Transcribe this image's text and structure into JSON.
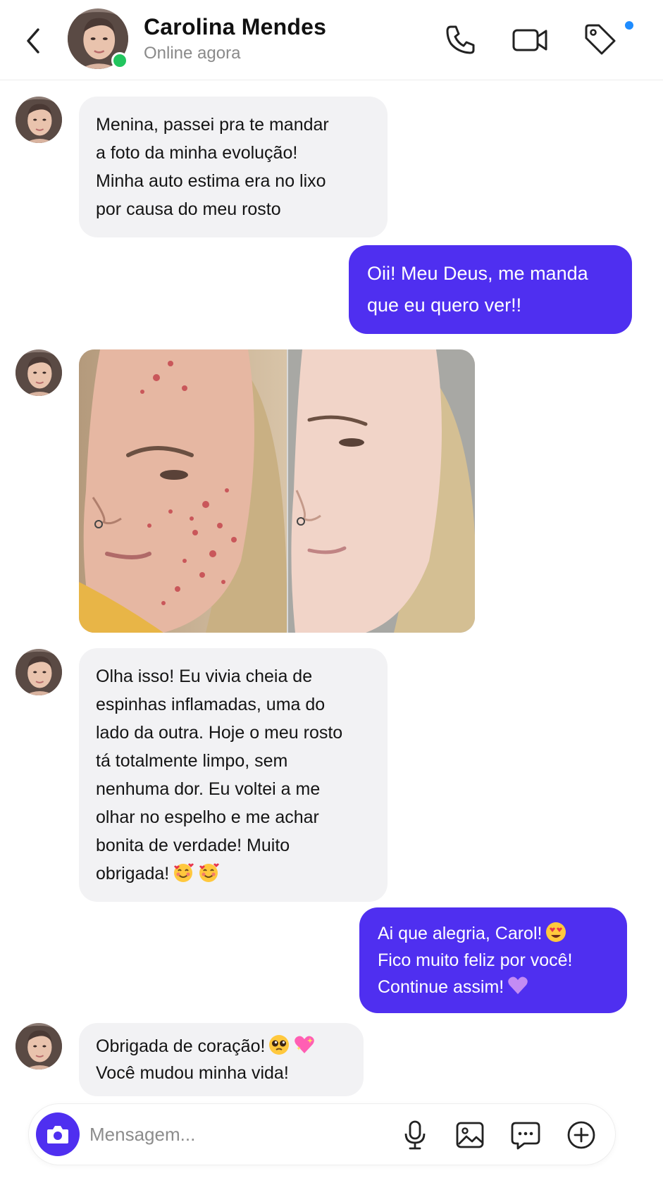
{
  "header": {
    "contact_name": "Carolina Mendes",
    "status": "Online agora",
    "icons": [
      "back-icon",
      "phone-icon",
      "video-icon",
      "tag-icon"
    ],
    "notification_badge_color": "#1e8cff",
    "online_color": "#22c55e"
  },
  "messages": [
    {
      "from": "contact",
      "lines": [
        "Menina, passei pra te mandar",
        "a foto da minha evolução!",
        "Minha auto estima era no lixo",
        "por causa do meu rosto"
      ]
    },
    {
      "from": "me",
      "lines": [
        "Oii! Meu Deus, me manda",
        "que eu quero ver!!"
      ]
    },
    {
      "from": "contact",
      "type": "photo",
      "description": "before-after-photo"
    },
    {
      "from": "contact",
      "lines": [
        "Olha isso! Eu vivia cheia de",
        "espinhas inflamadas, uma do",
        "lado da outra. Hoje o meu rosto",
        "tá totalmente limpo, sem",
        "nenhuma dor. Eu voltei a me",
        "olhar no espelho e me achar",
        "bonita de verdade! Muito",
        "obrigada!"
      ],
      "emoji": [
        "smiling-face-with-hearts",
        "smiling-face-with-hearts"
      ]
    },
    {
      "from": "me",
      "lines": [
        "Ai que alegria, Carol!",
        "Fico muito feliz por você!",
        "Continue assim!"
      ],
      "emoji": [
        "heart-eyes",
        "purple-heart"
      ]
    },
    {
      "from": "contact",
      "lines": [
        "Obrigada de coração!",
        "Você mudou minha vida!"
      ],
      "emoji": [
        "pleading-face",
        "sparkling-heart"
      ]
    }
  ],
  "composer": {
    "placeholder": "Mensagem...",
    "icons": [
      "camera-icon",
      "microphone-icon",
      "image-icon",
      "chat-icon",
      "plus-circle-icon"
    ]
  },
  "colors": {
    "accent": "#4f2ff0",
    "incoming_bubble": "#f2f2f4",
    "secondary_text": "#8a8a8a"
  }
}
